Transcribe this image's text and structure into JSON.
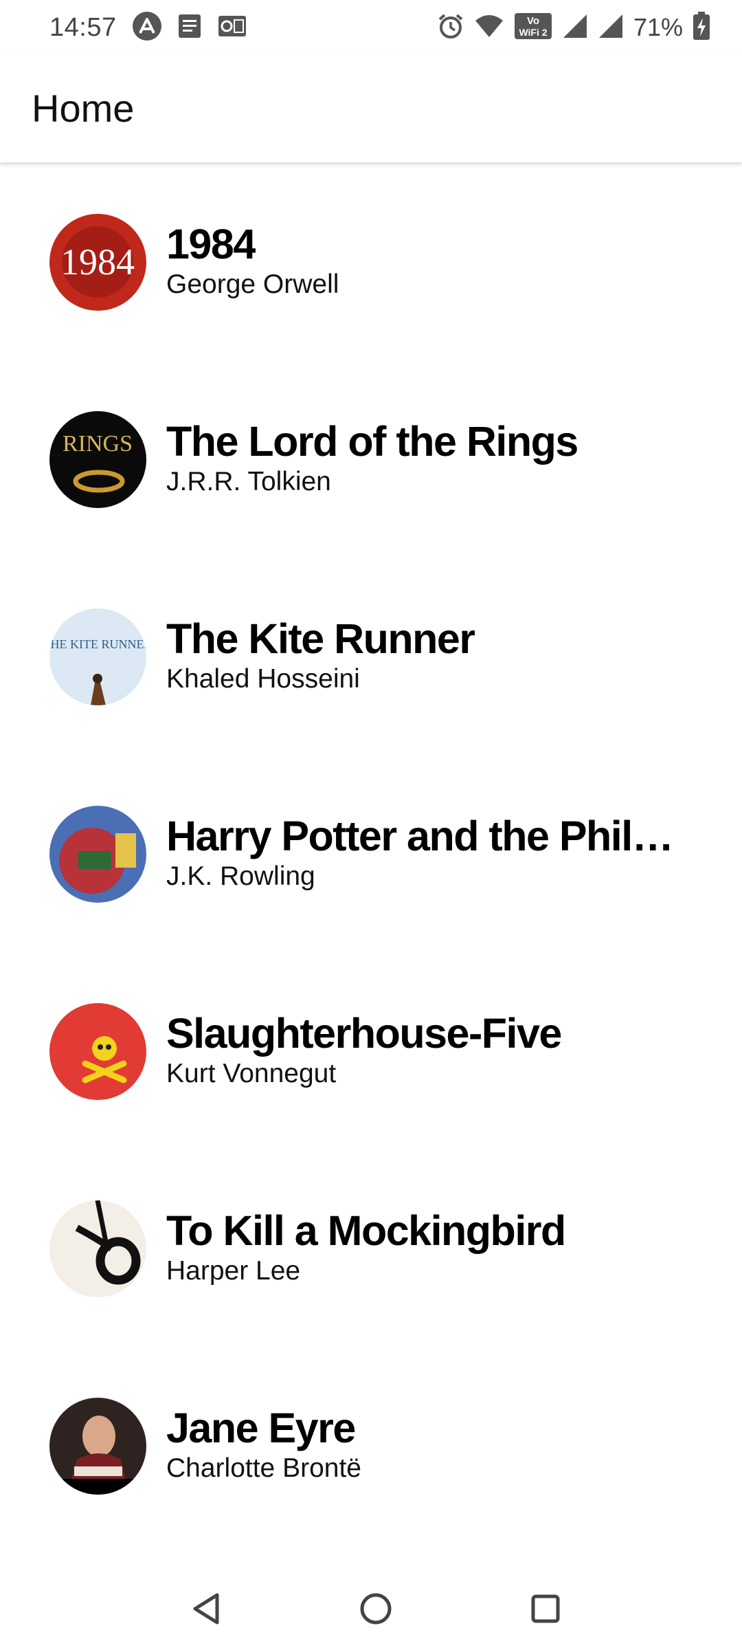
{
  "status_bar": {
    "time": "14:57",
    "left_icons": [
      "vpn-icon",
      "notes-icon",
      "outlook-icon"
    ],
    "right_icons": [
      "alarm-icon",
      "wifi-icon",
      "vowifi-icon",
      "signal-icon",
      "signal-icon"
    ],
    "vowifi_label": "Vo WiFi",
    "battery_percent": "71%"
  },
  "app_bar": {
    "title": "Home"
  },
  "books": [
    {
      "title": "1984",
      "author": "George Orwell",
      "cover_text": "1984",
      "cover_color": "#c0281c"
    },
    {
      "title": "The Lord of the Rings",
      "author": "J.R.R. Tolkien",
      "cover_text": "RINGS",
      "cover_color": "#0a0a0a"
    },
    {
      "title": "The Kite Runner",
      "author": "Khaled Hosseini",
      "cover_text": "THE KITE RUNNER",
      "cover_color": "#dce9f4"
    },
    {
      "title": "Harry Potter and the Philos...",
      "author": "J.K. Rowling",
      "cover_text": "",
      "cover_color": "#b8323a"
    },
    {
      "title": "Slaughterhouse-Five",
      "author": "Kurt Vonnegut",
      "cover_text": "",
      "cover_color": "#e23a35"
    },
    {
      "title": "To Kill a Mockingbird",
      "author": "Harper Lee",
      "cover_text": "",
      "cover_color": "#f4efe6"
    },
    {
      "title": "Jane Eyre",
      "author": "Charlotte Brontë",
      "cover_text": "",
      "cover_color": "#2e2320"
    }
  ],
  "nav_bar": {
    "buttons": [
      "back-icon",
      "home-icon",
      "recents-icon"
    ]
  }
}
